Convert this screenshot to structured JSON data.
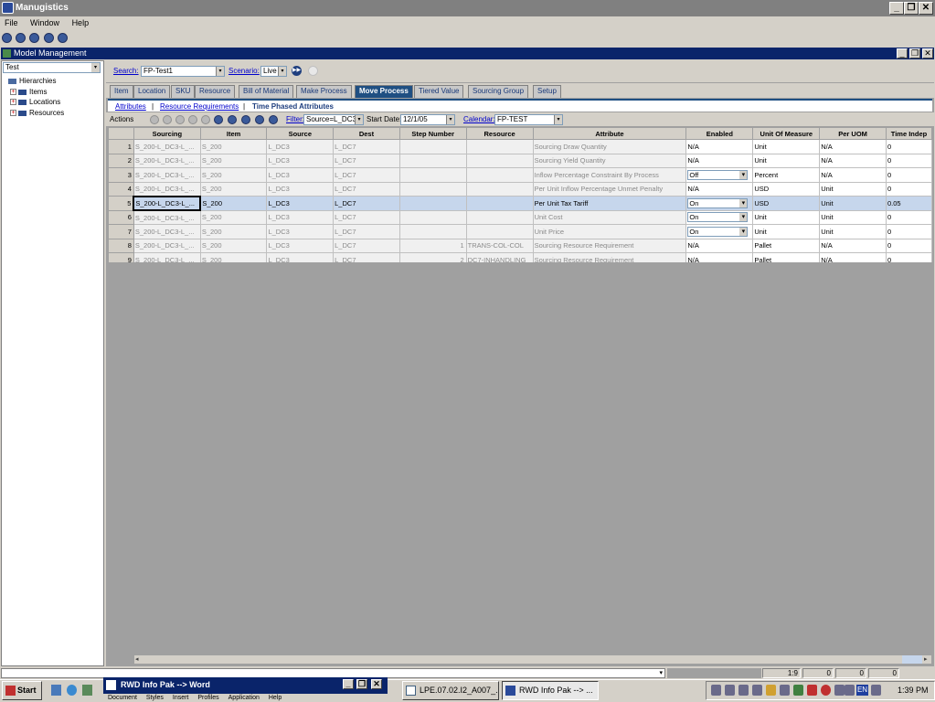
{
  "app": {
    "title": "Manugistics",
    "menu": [
      "File",
      "Window",
      "Help"
    ]
  },
  "window": {
    "title": "Model Management"
  },
  "left": {
    "selector_value": "Test",
    "tree": {
      "root": "Hierarchies",
      "children": [
        "Items",
        "Locations",
        "Resources"
      ]
    }
  },
  "search": {
    "label": "Search:",
    "value": "FP-Test1",
    "scenario_label": "Scenario:",
    "scenario_value": "Live"
  },
  "tabs": [
    "Item",
    "Location",
    "SKU",
    "Resource",
    "Bill of Material",
    "Make Process",
    "Move Process",
    "Tiered Value",
    "Sourcing Group",
    "Setup"
  ],
  "active_tab": "Move Process",
  "subtabs": {
    "attributes": "Attributes",
    "sep": "|",
    "resource_req": "Resource Requirements",
    "time_phased": "Time Phased Attributes"
  },
  "actions": {
    "label": "Actions",
    "filter_label": "Filter:",
    "filter_value": "Source=L_DC3",
    "start_date_label": "Start Date:",
    "start_date_value": "12/1/05",
    "calendar_label": "Calendar:",
    "calendar_value": "FP-TEST"
  },
  "grid": {
    "columns": [
      "Sourcing",
      "Item",
      "Source",
      "Dest",
      "Step Number",
      "Resource",
      "Attribute",
      "Enabled",
      "Unit Of Measure",
      "Per UOM",
      "Time Indep"
    ],
    "rows": [
      {
        "n": "1",
        "sourcing": "S_200-L_DC3-L_...",
        "item": "S_200",
        "source": "L_DC3",
        "dest": "L_DC7",
        "step": "",
        "resource": "",
        "attribute": "Sourcing Draw Quantity",
        "enabled": "N/A",
        "uom": "Unit",
        "per_uom": "N/A",
        "time": "0"
      },
      {
        "n": "2",
        "sourcing": "S_200-L_DC3-L_...",
        "item": "S_200",
        "source": "L_DC3",
        "dest": "L_DC7",
        "step": "",
        "resource": "",
        "attribute": "Sourcing Yield Quantity",
        "enabled": "N/A",
        "uom": "Unit",
        "per_uom": "N/A",
        "time": "0"
      },
      {
        "n": "3",
        "sourcing": "S_200-L_DC3-L_...",
        "item": "S_200",
        "source": "L_DC3",
        "dest": "L_DC7",
        "step": "",
        "resource": "",
        "attribute": "Inflow Percentage Constraint By Process",
        "enabled": "Off",
        "uom": "Percent",
        "per_uom": "N/A",
        "time": "0"
      },
      {
        "n": "4",
        "sourcing": "S_200-L_DC3-L_...",
        "item": "S_200",
        "source": "L_DC3",
        "dest": "L_DC7",
        "step": "",
        "resource": "",
        "attribute": "Per Unit Inflow Percentage Unmet Penalty",
        "enabled": "N/A",
        "uom": "USD",
        "per_uom": "Unit",
        "time": "0"
      },
      {
        "n": "5",
        "sourcing": "S_200-L_DC3-L_...",
        "item": "S_200",
        "source": "L_DC3",
        "dest": "L_DC7",
        "step": "",
        "resource": "",
        "attribute": "Per Unit Tax Tariff",
        "enabled": "On",
        "uom": "USD",
        "per_uom": "Unit",
        "time": "0.05"
      },
      {
        "n": "6",
        "sourcing": "S_200-L_DC3-L_...",
        "item": "S_200",
        "source": "L_DC3",
        "dest": "L_DC7",
        "step": "",
        "resource": "",
        "attribute": "Unit Cost",
        "enabled": "On",
        "uom": "Unit",
        "per_uom": "Unit",
        "time": "0"
      },
      {
        "n": "7",
        "sourcing": "S_200-L_DC3-L_...",
        "item": "S_200",
        "source": "L_DC3",
        "dest": "L_DC7",
        "step": "",
        "resource": "",
        "attribute": "Unit Price",
        "enabled": "On",
        "uom": "Unit",
        "per_uom": "Unit",
        "time": "0"
      },
      {
        "n": "8",
        "sourcing": "S_200-L_DC3-L_...",
        "item": "S_200",
        "source": "L_DC3",
        "dest": "L_DC7",
        "step": "1",
        "resource": "TRANS-COL-COL",
        "attribute": "Sourcing Resource Requirement",
        "enabled": "N/A",
        "uom": "Pallet",
        "per_uom": "N/A",
        "time": "0"
      },
      {
        "n": "9",
        "sourcing": "S_200-L_DC3-L_...",
        "item": "S_200",
        "source": "L_DC3",
        "dest": "L_DC7",
        "step": "2",
        "resource": "DC7-INHANDLING",
        "attribute": "Sourcing Resource Requirement",
        "enabled": "N/A",
        "uom": "Pallet",
        "per_uom": "N/A",
        "time": "0"
      }
    ]
  },
  "status": {
    "pos": "1:9",
    "a": "0",
    "b": "0",
    "c": "0"
  },
  "taskbar": {
    "start": "Start",
    "word_window": "RWD Info Pak --> Word",
    "word_menu": [
      "Document",
      "Styles",
      "Insert",
      "Profiles",
      "Application",
      "Help"
    ],
    "btn1": "LPE.07.02.I2_A007_...",
    "btn2": "RWD Info Pak --> ...",
    "lang": "EN",
    "clock": "1:39 PM"
  }
}
